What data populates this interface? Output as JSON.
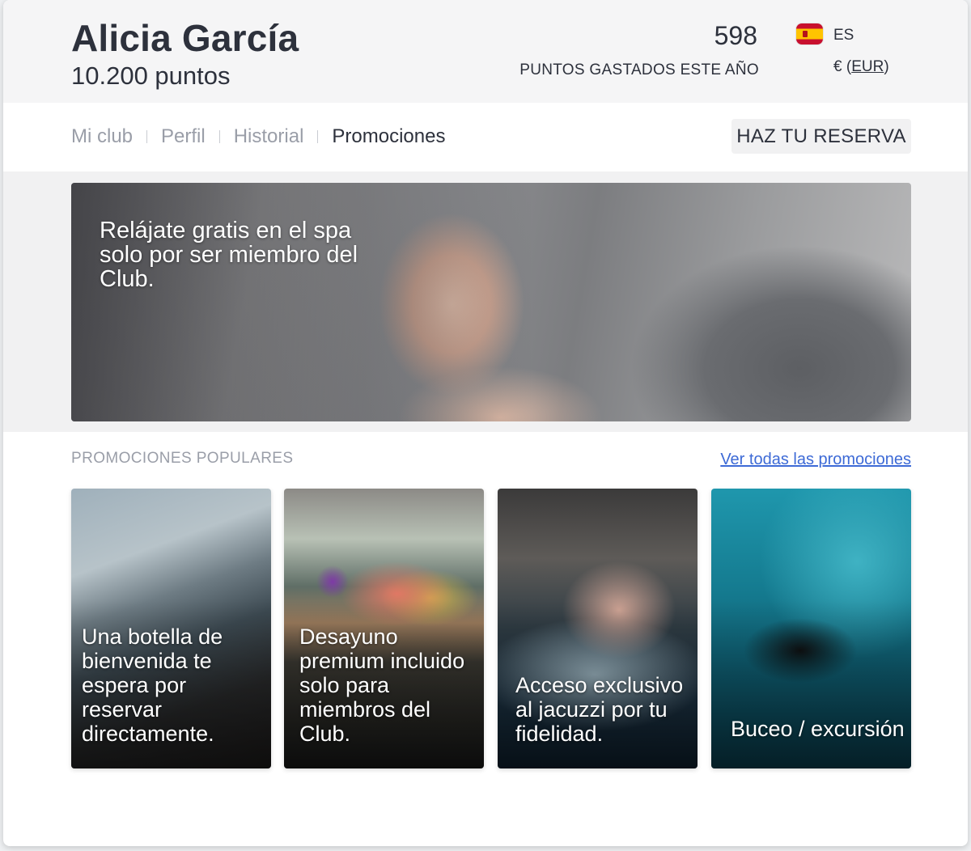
{
  "header": {
    "user_name": "Alicia García",
    "points": "10.200 puntos",
    "spent_value": "598",
    "spent_label": "PUNTOS GASTADOS ESTE AÑO",
    "language": "ES",
    "currency_symbol": "€ (",
    "currency_code": "EUR",
    "currency_close": ")"
  },
  "nav": {
    "items": [
      "Mi club",
      "Perfil",
      "Historial",
      "Promociones"
    ],
    "active": "Promociones",
    "reserve_button": "HAZ TU RESERVA"
  },
  "hero": {
    "text": "Relájate gratis en el spa solo por ser miembro del Club."
  },
  "promotions": {
    "section_title": "PROMOCIONES POPULARES",
    "view_all": "Ver todas las promociones",
    "cards": [
      {
        "text": "Una botella de bienvenida te espera por reservar directamente."
      },
      {
        "text": "Desayuno premium incluido solo para miembros del Club."
      },
      {
        "text": "Acceso exclusivo al jacuzzi por tu fidelidad."
      },
      {
        "text": "Buceo / excursión"
      }
    ]
  },
  "colors": {
    "link": "#3d6ad6",
    "text_dark": "#2d313c",
    "text_muted": "#9a9ea8",
    "header_bg": "#f5f5f6"
  }
}
